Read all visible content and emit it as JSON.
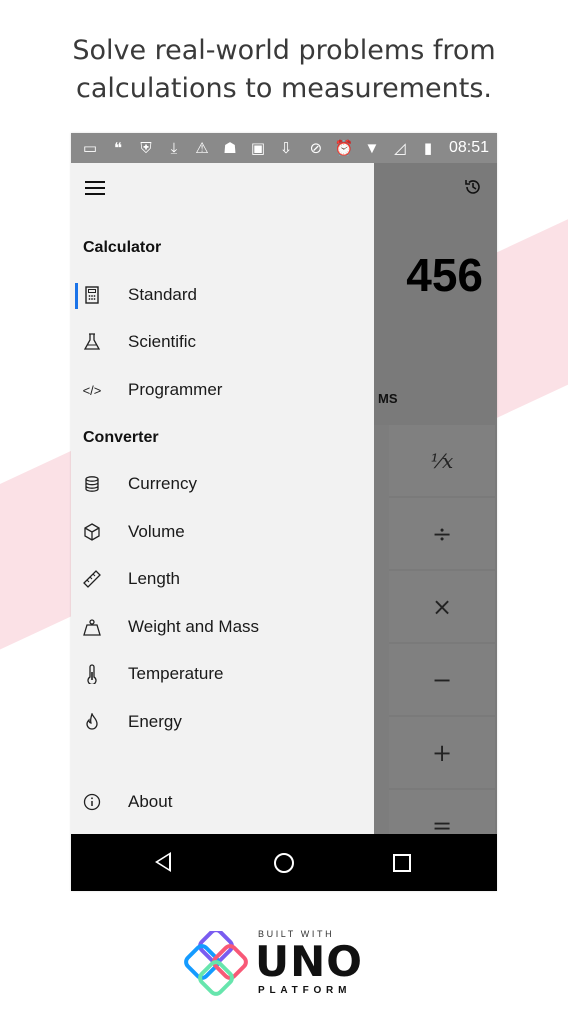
{
  "headline": {
    "line1": "Solve real-world problems from",
    "line2": "calculations to measurements."
  },
  "status_bar": {
    "time": "08:51",
    "left_icons": [
      "message-icon",
      "chat-icon",
      "shield-icon",
      "download-icon",
      "warning-icon",
      "android-icon",
      "image-icon",
      "download-box-icon"
    ],
    "right_icons": [
      "do-not-disturb-icon",
      "alarm-icon",
      "wifi-icon",
      "signal-icon",
      "battery-icon"
    ]
  },
  "calculator": {
    "display_value": "456",
    "memory_label": "MS",
    "keys": [
      "⅟x",
      "÷",
      "×",
      "−",
      "+",
      "="
    ]
  },
  "drawer": {
    "sections": [
      {
        "title": "Calculator",
        "items": [
          {
            "label": "Standard",
            "icon": "calculator-icon",
            "selected": true
          },
          {
            "label": "Scientific",
            "icon": "flask-icon"
          },
          {
            "label": "Programmer",
            "icon": "code-icon"
          }
        ]
      },
      {
        "title": "Converter",
        "items": [
          {
            "label": "Currency",
            "icon": "coins-icon"
          },
          {
            "label": "Volume",
            "icon": "cube-icon"
          },
          {
            "label": "Length",
            "icon": "ruler-icon"
          },
          {
            "label": "Weight and Mass",
            "icon": "weight-icon"
          },
          {
            "label": "Temperature",
            "icon": "thermometer-icon"
          },
          {
            "label": "Energy",
            "icon": "flame-icon"
          }
        ]
      }
    ],
    "footer": {
      "label": "About",
      "icon": "info-icon"
    }
  },
  "branding": {
    "built_with": "BUILT WITH",
    "name": "UNO",
    "platform": "PLATFORM"
  },
  "colors": {
    "accent": "#1a73e8",
    "band": "#fbe1e6",
    "drawer_bg": "#f2f2f2",
    "calc_bg": "#7a7a7a"
  }
}
